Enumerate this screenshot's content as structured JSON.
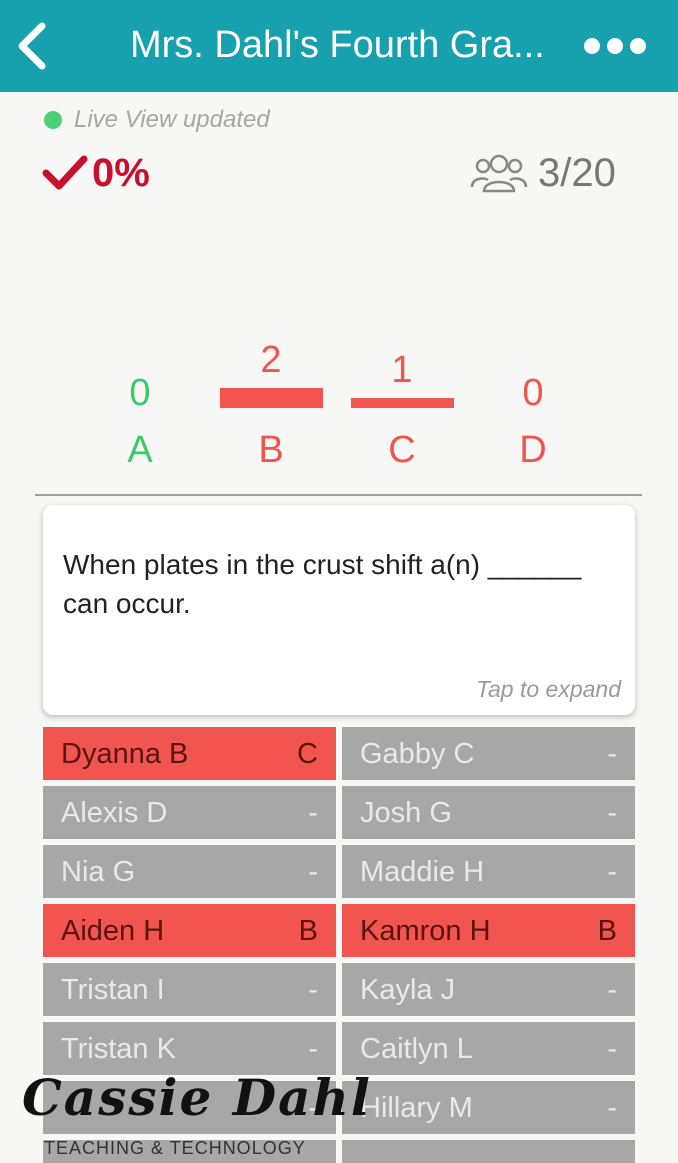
{
  "header": {
    "title": "Mrs. Dahl's Fourth Gra...",
    "back_icon": "chevron-left-icon",
    "more_icon": "more-horizontal-icon",
    "bg_color": "#17a0ad"
  },
  "status": {
    "text": "Live View updated",
    "dot_color": "#4ccf76"
  },
  "accuracy": {
    "value": "0%",
    "icon": "checkmark-icon",
    "color": "#c8102e"
  },
  "participants": {
    "value": "3/20",
    "icon": "group-icon"
  },
  "results": {
    "options": [
      {
        "label": "A",
        "count": "0",
        "correct": true
      },
      {
        "label": "B",
        "count": "2",
        "correct": false
      },
      {
        "label": "C",
        "count": "1",
        "correct": false
      },
      {
        "label": "D",
        "count": "0",
        "correct": false
      }
    ],
    "correct_color": "#3cc86b",
    "incorrect_color": "#f25450"
  },
  "question": {
    "text": "When plates in the crust shift a(n) ______ can occur.",
    "expand_hint": "Tap to expand"
  },
  "students": [
    {
      "name": "Dyanna B",
      "answer": "C"
    },
    {
      "name": "Gabby C",
      "answer": "-"
    },
    {
      "name": "Alexis D",
      "answer": "-"
    },
    {
      "name": "Josh G",
      "answer": "-"
    },
    {
      "name": "Nia G",
      "answer": "-"
    },
    {
      "name": "Maddie H",
      "answer": "-"
    },
    {
      "name": "Aiden H",
      "answer": "B"
    },
    {
      "name": "Kamron H",
      "answer": "B"
    },
    {
      "name": "Tristan I",
      "answer": "-"
    },
    {
      "name": "Kayla J",
      "answer": "-"
    },
    {
      "name": "Tristan K",
      "answer": "-"
    },
    {
      "name": "Caitlyn L",
      "answer": "-"
    },
    {
      "name": "",
      "answer": "-"
    },
    {
      "name": "Hillary M",
      "answer": "-"
    }
  ],
  "watermark": {
    "name": "Cassie Dahl",
    "tagline": "TEACHING & TECHNOLOGY"
  }
}
